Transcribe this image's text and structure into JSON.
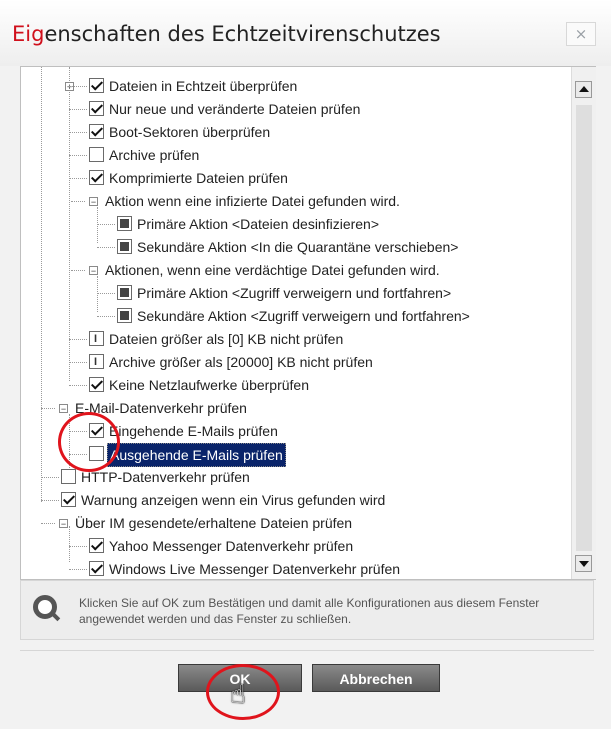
{
  "dialog": {
    "title_accent": "Eig",
    "title_rest": "enschaften des Echtzeitvirenschutzes",
    "close_label": "×"
  },
  "tree": [
    {
      "label": "Dateien in Echtzeit überprüfen",
      "type": "checkbox",
      "checked": true,
      "expander": "+"
    },
    {
      "label": "Nur neue und veränderte Dateien prüfen",
      "type": "checkbox",
      "checked": true
    },
    {
      "label": "Boot-Sektoren überprüfen",
      "type": "checkbox",
      "checked": true
    },
    {
      "label": "Archive prüfen",
      "type": "checkbox",
      "checked": false
    },
    {
      "label": "Komprimierte Dateien prüfen",
      "type": "checkbox",
      "checked": true
    },
    {
      "label": "Aktion wenn eine infizierte Datei gefunden wird.",
      "type": "group",
      "expander": "−"
    },
    {
      "label": "Primäre Aktion <Dateien desinfizieren>",
      "type": "action"
    },
    {
      "label": "Sekundäre Aktion <In die Quarantäne verschieben>",
      "type": "action"
    },
    {
      "label": "Aktionen, wenn eine verdächtige Datei gefunden wird.",
      "type": "group",
      "expander": "−"
    },
    {
      "label": "Primäre Aktion <Zugriff verweigern und fortfahren>",
      "type": "action"
    },
    {
      "label": "Sekundäre Aktion <Zugriff verweigern und fortfahren>",
      "type": "action"
    },
    {
      "label": "Dateien größer als [0] KB nicht prüfen",
      "type": "number"
    },
    {
      "label": "Archive größer als [20000] KB nicht prüfen",
      "type": "number"
    },
    {
      "label": "Keine Netzlaufwerke überprüfen",
      "type": "checkbox",
      "checked": true
    },
    {
      "label": "E-Mail-Datenverkehr prüfen",
      "type": "group",
      "expander": "−"
    },
    {
      "label": "Eingehende E-Mails prüfen",
      "type": "checkbox",
      "checked": true
    },
    {
      "label": "Ausgehende E-Mails prüfen",
      "type": "checkbox",
      "checked": false,
      "selected": true
    },
    {
      "label": "HTTP-Datenverkehr prüfen",
      "type": "checkbox",
      "checked": false
    },
    {
      "label": "Warnung anzeigen wenn ein Virus gefunden wird",
      "type": "checkbox",
      "checked": true
    },
    {
      "label": "Über IM gesendete/erhaltene Dateien prüfen",
      "type": "group",
      "expander": "−"
    },
    {
      "label": "Yahoo Messenger Datenverkehr prüfen",
      "type": "checkbox",
      "checked": true
    },
    {
      "label": "Windows Live Messenger Datenverkehr prüfen",
      "type": "checkbox",
      "checked": true
    }
  ],
  "info": {
    "text": "Klicken Sie auf OK zum Bestätigen und damit alle Konfigurationen aus diesem Fenster angewendet werden und das Fenster zu schließen."
  },
  "buttons": {
    "ok": "OK",
    "cancel": "Abbrechen"
  },
  "colors": {
    "title_accent": "#d0101c",
    "annotation_circle": "#e0141c",
    "selection": "#0a246a"
  }
}
